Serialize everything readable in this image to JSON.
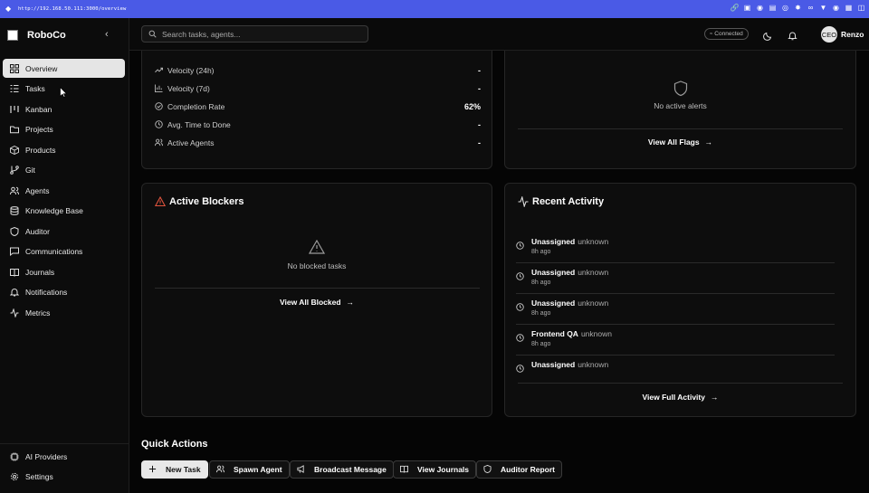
{
  "browser": {
    "url": "http://192.168.50.111:3000/overview",
    "extension_icons": [
      "link-icon",
      "media-icon",
      "camera-icon",
      "window-icon",
      "globe-icon",
      "bug-icon",
      "extension-icon",
      "puzzle-icon",
      "shield-icon",
      "grid-icon",
      "sidebar-icon"
    ]
  },
  "sidebar": {
    "brand": "RoboCo",
    "collapse_icon": "chevron-left-icon",
    "items": [
      {
        "label": "Overview",
        "icon": "grid-icon",
        "active": true
      },
      {
        "label": "Tasks",
        "icon": "list-icon"
      },
      {
        "label": "Kanban",
        "icon": "kanban-icon"
      },
      {
        "label": "Projects",
        "icon": "folder-icon"
      },
      {
        "label": "Products",
        "icon": "box-icon"
      },
      {
        "label": "Git",
        "icon": "git-branch-icon"
      },
      {
        "label": "Agents",
        "icon": "users-icon"
      },
      {
        "label": "Knowledge Base",
        "icon": "database-icon"
      },
      {
        "label": "Auditor",
        "icon": "shield-icon"
      },
      {
        "label": "Communications",
        "icon": "message-icon"
      },
      {
        "label": "Journals",
        "icon": "book-icon"
      },
      {
        "label": "Notifications",
        "icon": "bell-icon"
      },
      {
        "label": "Metrics",
        "icon": "activity-icon"
      }
    ],
    "bottom_items": [
      {
        "label": "AI Providers",
        "icon": "chip-icon"
      },
      {
        "label": "Settings",
        "icon": "gear-icon"
      }
    ]
  },
  "header": {
    "search_placeholder": "Search tasks, agents...",
    "status": "Connected",
    "user_initials": "CEO",
    "user_name": "Renzo"
  },
  "metrics": [
    {
      "label": "Velocity (24h)",
      "value": "-",
      "icon": "trending-up-icon"
    },
    {
      "label": "Velocity (7d)",
      "value": "-",
      "icon": "bar-chart-icon"
    },
    {
      "label": "Completion Rate",
      "value": "62%",
      "icon": "check-circle-icon"
    },
    {
      "label": "Avg. Time to Done",
      "value": "-",
      "icon": "clock-icon"
    },
    {
      "label": "Active Agents",
      "value": "-",
      "icon": "users-icon"
    }
  ],
  "flags": {
    "empty_text": "No active alerts",
    "link": "View All Flags"
  },
  "blockers": {
    "title": "Active Blockers",
    "empty_text": "No blocked tasks",
    "link": "View All Blocked"
  },
  "activity": {
    "title": "Recent Activity",
    "items": [
      {
        "who": "Unassigned",
        "what": "unknown",
        "when": "8h ago"
      },
      {
        "who": "Unassigned",
        "what": "unknown",
        "when": "8h ago"
      },
      {
        "who": "Unassigned",
        "what": "unknown",
        "when": "8h ago"
      },
      {
        "who": "Frontend QA",
        "what": "unknown",
        "when": "8h ago"
      },
      {
        "who": "Unassigned",
        "what": "unknown",
        "when": ""
      }
    ],
    "link": "View Full Activity"
  },
  "quick_actions": {
    "title": "Quick Actions",
    "buttons": [
      {
        "label": "New Task",
        "icon": "plus-icon"
      },
      {
        "label": "Spawn Agent",
        "icon": "users-icon"
      },
      {
        "label": "Broadcast Message",
        "icon": "megaphone-icon"
      },
      {
        "label": "View Journals",
        "icon": "book-icon"
      },
      {
        "label": "Auditor Report",
        "icon": "shield-icon"
      }
    ]
  }
}
